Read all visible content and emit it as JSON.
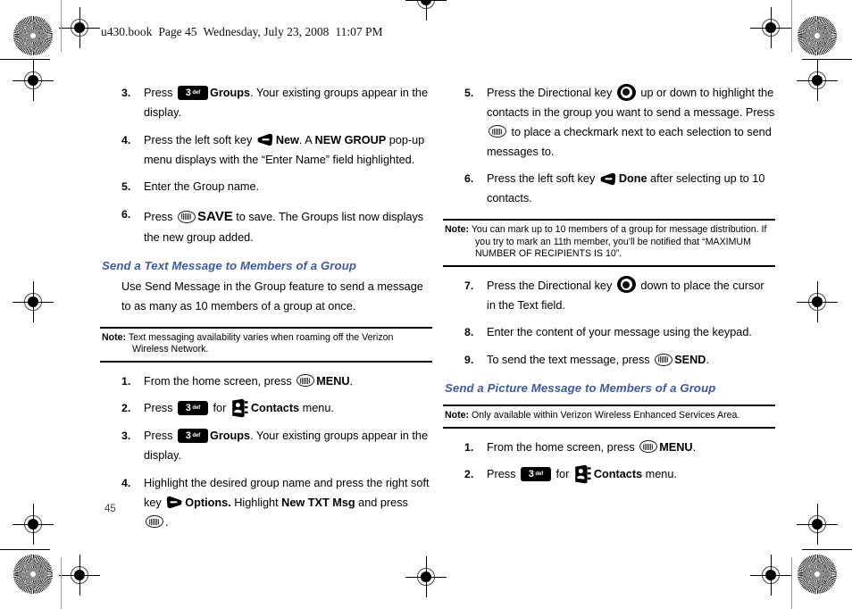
{
  "page": {
    "header_line": "u430.book  Page 45  Wednesday, July 23, 2008  11:07 PM",
    "header_file": "u430.book",
    "header_page": "Page 45",
    "header_date": "Wednesday, July 23, 2008",
    "header_time": "11:07 PM",
    "folio": "45",
    "heading_color": "#3b59a6"
  },
  "icons": {
    "key3_digit": "3",
    "key3_letters": "def",
    "ok_button": "ok-key-icon",
    "left_soft_key": "left-soft-key-icon",
    "right_soft_key": "right-soft-key-icon",
    "directional_key": "directional-key-icon",
    "contacts_book": "contacts-book-icon"
  },
  "left_column": {
    "steps_continued": [
      {
        "num": "3.",
        "parts": [
          {
            "t": "text",
            "v": "Press "
          },
          {
            "t": "key3"
          },
          {
            "t": "bold",
            "v": "Groups"
          },
          {
            "t": "text",
            "v": ". Your existing groups appear in the display."
          }
        ]
      },
      {
        "num": "4.",
        "parts": [
          {
            "t": "text",
            "v": "Press the left soft key "
          },
          {
            "t": "lsk"
          },
          {
            "t": "bold",
            "v": "New"
          },
          {
            "t": "text",
            "v": ". A "
          },
          {
            "t": "bold",
            "v": "NEW GROUP"
          },
          {
            "t": "text",
            "v": " pop-up menu displays with the “Enter Name” field highlighted."
          }
        ]
      },
      {
        "num": "5.",
        "parts": [
          {
            "t": "text",
            "v": "Enter the Group name."
          }
        ]
      },
      {
        "num": "6.",
        "parts": [
          {
            "t": "text",
            "v": "Press "
          },
          {
            "t": "ok"
          },
          {
            "t": "bigbold",
            "v": "SAVE"
          },
          {
            "t": "text",
            "v": " to save. The Groups list now displays the new group added."
          }
        ]
      }
    ],
    "section_heading": "Send a Text Message to Members of a Group",
    "intro_paragraph": "Use Send Message in the Group feature to send a message to as many as 10 members of a group at once.",
    "note": {
      "label": "Note:",
      "text": "Text messaging availability varies when roaming off the Verizon Wireless Network."
    },
    "steps": [
      {
        "num": "1.",
        "parts": [
          {
            "t": "text",
            "v": "From the home screen, press "
          },
          {
            "t": "ok"
          },
          {
            "t": "bold",
            "v": "MENU"
          },
          {
            "t": "text",
            "v": "."
          }
        ]
      },
      {
        "num": "2.",
        "parts": [
          {
            "t": "text",
            "v": "Press "
          },
          {
            "t": "key3"
          },
          {
            "t": "text",
            "v": " for "
          },
          {
            "t": "contacts"
          },
          {
            "t": "bold",
            "v": "Contacts"
          },
          {
            "t": "text",
            "v": " menu."
          }
        ]
      },
      {
        "num": "3.",
        "parts": [
          {
            "t": "text",
            "v": "Press "
          },
          {
            "t": "key3"
          },
          {
            "t": "bold",
            "v": "Groups"
          },
          {
            "t": "text",
            "v": ". Your existing groups appear in the display."
          }
        ]
      },
      {
        "num": "4.",
        "parts": [
          {
            "t": "text",
            "v": "Highlight the desired group name and press the right soft key "
          },
          {
            "t": "rsk"
          },
          {
            "t": "bold",
            "v": "Options."
          },
          {
            "t": "text",
            "v": " Highlight "
          },
          {
            "t": "bold",
            "v": "New TXT Msg"
          },
          {
            "t": "text",
            "v": " and press "
          },
          {
            "t": "ok"
          },
          {
            "t": "text",
            "v": "."
          }
        ]
      }
    ]
  },
  "right_column": {
    "steps_top": [
      {
        "num": "5.",
        "parts": [
          {
            "t": "text",
            "v": "Press the Directional key "
          },
          {
            "t": "dir"
          },
          {
            "t": "text",
            "v": " up or down to highlight the contacts in the group you want to send a message. Press "
          },
          {
            "t": "ok"
          },
          {
            "t": "text",
            "v": " to place a checkmark next to each selection to send messages to."
          }
        ]
      },
      {
        "num": "6.",
        "parts": [
          {
            "t": "text",
            "v": "Press the left soft key "
          },
          {
            "t": "lsk"
          },
          {
            "t": "bold",
            "v": "Done"
          },
          {
            "t": "text",
            "v": " after selecting up to 10 contacts."
          }
        ]
      }
    ],
    "note_top": {
      "label": "Note:",
      "text": "You can mark up to 10 members of a group for message distribution. If you try to mark an 11th member, you’ll be notified that “MAXIMUM NUMBER OF RECIPIENTS IS 10”."
    },
    "steps_mid": [
      {
        "num": "7.",
        "parts": [
          {
            "t": "text",
            "v": "Press the Directional key "
          },
          {
            "t": "dir"
          },
          {
            "t": "text",
            "v": " down to place the cursor in the Text field."
          }
        ]
      },
      {
        "num": "8.",
        "parts": [
          {
            "t": "text",
            "v": "Enter the content of your message using the keypad."
          }
        ]
      },
      {
        "num": "9.",
        "parts": [
          {
            "t": "text",
            "v": "To send the text message, press "
          },
          {
            "t": "ok"
          },
          {
            "t": "bold",
            "v": "SEND"
          },
          {
            "t": "text",
            "v": "."
          }
        ]
      }
    ],
    "section_heading": "Send a Picture Message to Members of a Group",
    "note_bottom": {
      "label": "Note:",
      "text": "Only available within Verizon Wireless Enhanced Services Area."
    },
    "steps_bottom": [
      {
        "num": "1.",
        "parts": [
          {
            "t": "text",
            "v": "From the home screen, press "
          },
          {
            "t": "ok"
          },
          {
            "t": "bold",
            "v": "MENU"
          },
          {
            "t": "text",
            "v": "."
          }
        ]
      },
      {
        "num": "2.",
        "parts": [
          {
            "t": "text",
            "v": "Press "
          },
          {
            "t": "key3"
          },
          {
            "t": "text",
            "v": " for "
          },
          {
            "t": "contacts"
          },
          {
            "t": "bold",
            "v": "Contacts"
          },
          {
            "t": "text",
            "v": " menu."
          }
        ]
      }
    ]
  }
}
